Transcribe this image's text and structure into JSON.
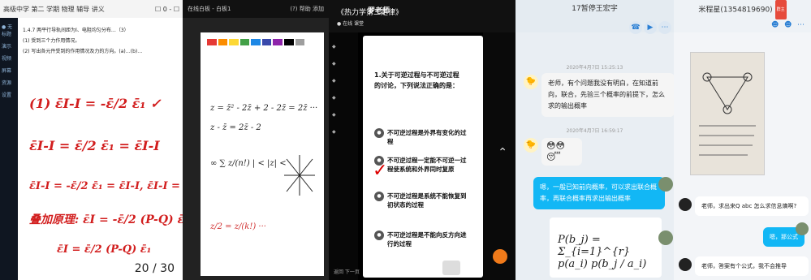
{
  "p1": {
    "title": "高级中学 第二 学期 物理 辅导 讲义",
    "controls": "☐ 0 - ☐",
    "section": "1.4.7 两平行导轨间距为l、电阻均匀分布…（3）",
    "line1": "(1) 受到三个力作用情况。",
    "line2": "(2) 写出各元件受到的作用情况及力的方向。(a)…(b)…",
    "ink": [
      "(1) ε̄I-I = -ε̄/2 ε̄₁ ✓",
      "ε̄I-I = ε̄/2 ε̄₁ = ε̄I-I",
      "ε̄I-I = -ε̄/2 ε̄₁ = ε̄I-I, ε̄I-I = ε̄/2 ε̄₁",
      "叠加原理: ε̄I = -ε̄/2 (P-Q) ε̄₁",
      "ε̄I = ε̄/2 (P-Q) ε̄₁"
    ],
    "page": "20 / 30",
    "sidebar": [
      "● 无标题",
      "演示",
      "视频",
      "屏幕",
      "资源",
      "设置"
    ]
  },
  "p2": {
    "title": "在线白板 - 白板1",
    "right": "(?) 帮助  添加",
    "ink": [
      "z = z̄² - 2z̄ + 2 - 2z̄ = 2z̄ ···",
      "z - z̄ = 2z̄ - 2",
      "∞ ∑ z/(n!) | < |z| <",
      "z/2 = z/(k!) ···"
    ],
    "palette": [
      "#e53935",
      "#fb8c00",
      "#fdd835",
      "#43a047",
      "#1e88e5",
      "#3949ab",
      "#8e24aa",
      "#000000",
      "#9e9e9e"
    ]
  },
  "p3": {
    "title": "《热力学第二定律》",
    "teacher": "罗老师",
    "badge": "● 在线 课堂",
    "question": "1.关于可逆过程与不可逆过程的讨论，下列说法正确的是：",
    "options": [
      "不可逆过程是外界有变化的过程",
      "不可逆过程一定能不可逆一过程使系统和外界同时复原",
      "不可逆过程是系统不能恢复到初状态的过程",
      "不可逆过程是不能向反方向进行的过程"
    ],
    "side_items": [
      "◆",
      "◆",
      "◆",
      "◆",
      "◆",
      "◆"
    ],
    "bottomleft": "返回 下一页"
  },
  "p4": {
    "title": "17暂停王宏宇",
    "ts1": "2020年4月7日 15:25:13",
    "msg1": "老师，有个问题我没有明白，在知道前向，联合，先验三个概率的前提下，怎么求的输出概率",
    "ts2": "2020年4月7日 16:59:17",
    "emoji": "😳😳😴",
    "msg2": "嗯，一般已知前向概率，可以求出联合概率，再联合概率再求出输出概率",
    "formula": "P(b_j) = Σ_{i=1}^{r} p(a_i) p(b_j / a_i)"
  },
  "p5": {
    "title": "米程星(1354819690)",
    "tag": "群主",
    "msg1": "老师，求出来Q abc 怎么求信息熵啊?",
    "msg2": "嗯，那公式",
    "msg3": "老师，答案有个公式，我不会推导"
  }
}
